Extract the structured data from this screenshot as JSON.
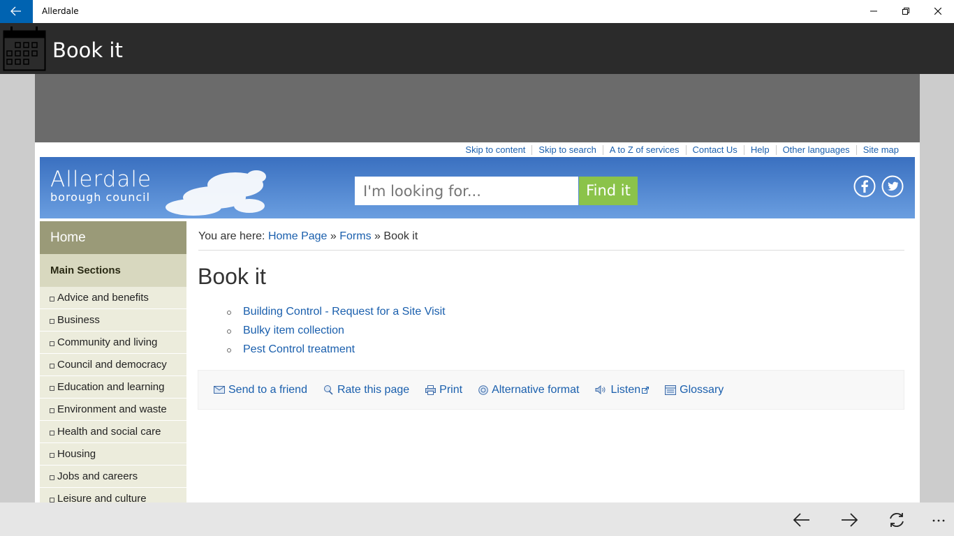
{
  "window": {
    "title": "Allerdale"
  },
  "app": {
    "title": "Book it"
  },
  "site": {
    "toplinks": [
      "Skip to content",
      "Skip to search",
      "A to Z of services",
      "Contact Us",
      "Help",
      "Other languages",
      "Site map"
    ],
    "logo_name": "Allerdale",
    "logo_sub": "borough council",
    "search_placeholder": "I'm looking for...",
    "search_button": "Find it"
  },
  "sidebar": {
    "home": "Home",
    "main_sections": "Main Sections",
    "items": [
      "Advice and benefits",
      "Business",
      "Community and living",
      "Council and democracy",
      "Education and learning",
      "Environment and waste",
      "Health and social care",
      "Housing",
      "Jobs and careers",
      "Leisure and culture"
    ]
  },
  "breadcrumb": {
    "prefix": "You are here:",
    "home": "Home Page",
    "forms": "Forms",
    "current": "Book it",
    "sep": "»"
  },
  "main": {
    "heading": "Book it",
    "links": [
      "Building Control - Request for a Site Visit",
      "Bulky item collection",
      "Pest Control treatment"
    ]
  },
  "tools": [
    "Send to a friend",
    "Rate this page",
    "Print",
    "Alternative format",
    "Listen",
    "Glossary"
  ],
  "colors": {
    "accent": "#0063b1",
    "link": "#1a5fad",
    "find_button": "#8bc34a",
    "sidebar_home": "#9a9a78"
  }
}
